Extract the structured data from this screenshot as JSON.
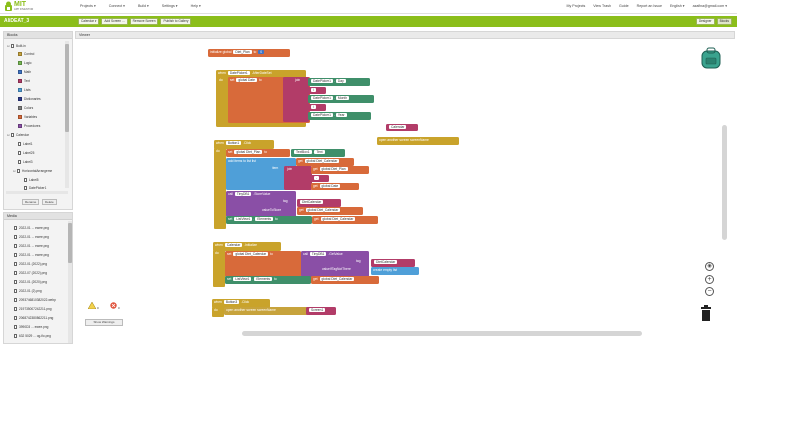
{
  "header": {
    "logo": "MIT",
    "logo_sub": "APP INVENTOR",
    "nav": [
      "Projects ▾",
      "Connect ▾",
      "Build ▾",
      "Settings ▾",
      "Help ▾"
    ],
    "right": [
      "My Projects",
      "View Trash",
      "Guide",
      "Report an Issue",
      "English ▾",
      "azafina@gmail.com ▾"
    ]
  },
  "project": {
    "name": "AliDEAT_3",
    "buttons": [
      "Calendar ▾",
      "Add Screen ...",
      "Remove Screen",
      "Publish to Gallery"
    ],
    "modes": [
      "Designer",
      "Blocks"
    ]
  },
  "blocks_panel": {
    "title": "Blocks",
    "builtin_label": "Built-in",
    "builtin": [
      {
        "label": "Control",
        "color": "#c7a33c"
      },
      {
        "label": "Logic",
        "color": "#76b852"
      },
      {
        "label": "Math",
        "color": "#3f74c6"
      },
      {
        "label": "Text",
        "color": "#b23c68"
      },
      {
        "label": "Lists",
        "color": "#4f9fd8"
      },
      {
        "label": "Dictionaries",
        "color": "#2d3a8c"
      },
      {
        "label": "Colors",
        "color": "#7d7d7d"
      },
      {
        "label": "Variables",
        "color": "#d86a3a"
      },
      {
        "label": "Procedures",
        "color": "#8a4fa6"
      }
    ],
    "screen_label": "Calendar",
    "components": [
      "Label1",
      "Label25",
      "Label3",
      "HorizontalArrangeme",
      "Label5",
      "DatePicker1"
    ],
    "rename": "Rename",
    "delete": "Delete"
  },
  "media_panel": {
    "title": "Media",
    "files": [
      "2022-01 ... ewee.png",
      "2022-01 ... ewee.png",
      "2022-01 ... ewee.png",
      "2022-01 ... ewee.png",
      "2022-01 (2022).png",
      "2022-07 (2022).png",
      "2022-01 (2020).png",
      "2022-01 (2).png",
      "2093746810382022.webp",
      "219735007242211.png",
      "2068742380862211.png",
      "3990D3 ... ewee.png",
      "632 5029 ... og-fio.png"
    ]
  },
  "viewer": {
    "title": "Viewer",
    "warnings_count_a": "0",
    "warnings_count_b": "0",
    "show_warnings": "Show Warnings"
  },
  "blocks": {
    "init": {
      "kw": "initialize global",
      "name": "Diet_Plan",
      "to": "to",
      "val": "0"
    },
    "dp_event": {
      "when": "when",
      "comp": "DatePicker1",
      "event": ".AfterDateSet",
      "do": "do",
      "set": "set",
      "var": "global Date",
      "to": "to",
      "join": "join",
      "d1": "DatePicker1",
      "p1": "Day",
      "s1": "/",
      "d2": "DatePicker1",
      "p2": "Month",
      "s2": "/",
      "d3": "DatePicker1",
      "p3": "Year"
    },
    "loose_calendar": "Calendar",
    "open_screen": "open another screen   screenName",
    "btn1_event": {
      "when": "when",
      "comp": "Button1",
      "event": ".Click",
      "do": "do",
      "set": "set",
      "var": "global Diet_Plan",
      "to": "to",
      "tb": "TextBox1",
      "tbp": "Text",
      "add": "add items to list   list",
      "get1": "get",
      "gvar1": "global Diet_Calendar",
      "item": "item",
      "join": "join",
      "get2": "get",
      "gvar2": "global Diet_Plan",
      "sep": "-",
      "get3": "get",
      "gvar3": "global Date",
      "call": "call",
      "db": "TinyDB1",
      "method": ".StoreValue",
      "tag": "tag",
      "tagv": "DietCalendar",
      "vts": "valueToStore",
      "get4": "get",
      "gvar4": "global Diet_Calendar",
      "set2": "set",
      "lv": "ListView1",
      "ele": "Elements",
      "to2": "to",
      "get5": "get",
      "gvar5": "global Diet_Calendar"
    },
    "cal_init": {
      "when": "when",
      "comp": "Calendar",
      "event": ".Initialize",
      "do": "do",
      "set": "set",
      "var": "global Diet_Calendar",
      "to": "to",
      "call": "call",
      "db": "TinyDB1",
      "method": ".GetValue",
      "tag": "tag",
      "tagv": "DietCalendar",
      "vit": "valueIfTagNotThere",
      "empty": "create empty list",
      "set2": "set",
      "lv": "ListView1",
      "ele": "Elements",
      "to2": "to",
      "get": "get",
      "gvar": "global Diet_Calendar"
    },
    "btn3_event": {
      "when": "when",
      "comp": "Button3",
      "event": ".Click",
      "do": "do",
      "open": "open another screen   screenName",
      "screen": "Screen1"
    }
  },
  "colors": {
    "accent": "#8bbe1a",
    "event": "#c9a32b",
    "variable": "#d86a3a",
    "text": "#b23c68",
    "component": "#3f8f6a",
    "list": "#4f9fd8",
    "tinydb": "#8a4fa6"
  }
}
